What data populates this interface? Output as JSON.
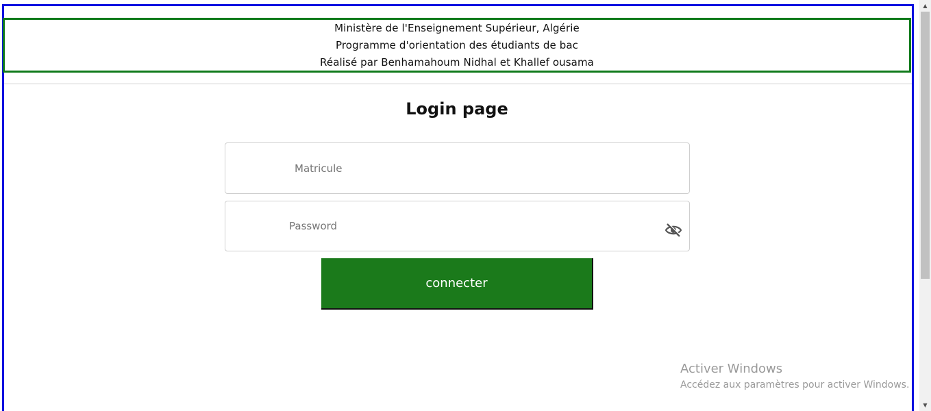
{
  "header": {
    "line1": "Ministère de l'Enseignement Supérieur, Algérie",
    "line2": "Programme d'orientation des étudiants de bac",
    "line3": "Réalisé par Benhamahoum Nidhal et Khallef ousama"
  },
  "login": {
    "title": "Login page",
    "matricule_placeholder": "Matricule",
    "matricule_value": "",
    "password_placeholder": "Password",
    "password_value": "",
    "password_toggle_icon": "eye-slash-icon",
    "submit_label": "connecter"
  },
  "watermark": {
    "title": "Activer Windows",
    "subtitle": "Accédez aux paramètres pour activer Windows."
  },
  "colors": {
    "outer_border": "#0a10e0",
    "header_border": "#0f7a1a",
    "button": "#1b7a1b"
  }
}
